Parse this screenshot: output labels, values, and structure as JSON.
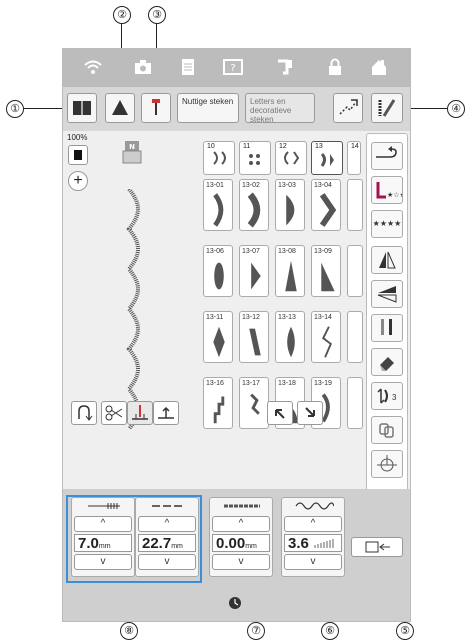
{
  "callouts": {
    "c1": "①",
    "c2": "②",
    "c3": "③",
    "c4": "④",
    "c5": "⑤",
    "c6": "⑥",
    "c7": "⑦",
    "c8": "⑧"
  },
  "status_icons": [
    "wifi-icon",
    "camera-icon",
    "document-icon",
    "help-icon",
    "thread-icon",
    "lock-icon",
    "home-icon"
  ],
  "toolbar": {
    "tab_utility": "Nuttige steken",
    "tab_letters": "Letters en decoratieve steken"
  },
  "left": {
    "zoom": "100%",
    "foot_letter": "N"
  },
  "tabs": [
    "10",
    "11",
    "12",
    "13",
    "14"
  ],
  "stitches": [
    [
      "13-01",
      "13-02",
      "13-03",
      "13-04"
    ],
    [
      "13-06",
      "13-07",
      "13-08",
      "13-09"
    ],
    [
      "13-11",
      "13-12",
      "13-13",
      "13-14"
    ],
    [
      "13-16",
      "13-17",
      "13-18",
      "13-19"
    ]
  ],
  "right_panel": {
    "star_label": "★★★★",
    "repeat_count": "3"
  },
  "settings": {
    "width_value": "7.0",
    "width_unit": "mm",
    "length_value": "22.7",
    "length_unit": "mm",
    "shift_value": "0.00",
    "shift_unit": "mm",
    "tension_value": "3.6",
    "up": "^",
    "down": "v"
  },
  "colors": {
    "highlight": "#3a8fd8",
    "screen_bg": "#efefef",
    "statusbar_bg": "#bcbcbc"
  }
}
